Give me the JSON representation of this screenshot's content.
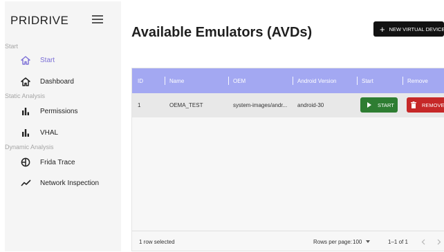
{
  "sidebar": {
    "brand": "PRIDRIVE",
    "sections": {
      "start": "Start",
      "static": "Static Analysis",
      "dynamic": "Dynamic Analysis"
    },
    "items": [
      {
        "label": "Start",
        "icon": "home-outline-icon",
        "active": true
      },
      {
        "label": "Dashboard",
        "icon": "home-icon",
        "active": false
      },
      {
        "label": "Permissions",
        "icon": "bar-chart-icon",
        "active": false
      },
      {
        "label": "VHAL",
        "icon": "bar-chart-icon",
        "active": false
      },
      {
        "label": "Frida Trace",
        "icon": "pie-chart-icon",
        "active": false
      },
      {
        "label": "Network Inspection",
        "icon": "trend-line-icon",
        "active": false
      }
    ]
  },
  "main": {
    "title": "Available Emulators (AVDs)",
    "new_button_label": "NEW VIRTUAL DEVICE"
  },
  "table": {
    "columns": [
      "ID",
      "Name",
      "OEM",
      "Android Version",
      "Start",
      "Remove"
    ],
    "rows": [
      {
        "id": "1",
        "name": "OEMA_TEST",
        "oem": "system-images/andr...",
        "android_version": "android-30",
        "start_label": "START",
        "remove_label": "REMOVE"
      }
    ],
    "footer": {
      "selected_text": "1 row selected",
      "rows_per_page_label": "Rows per page:",
      "rows_per_page_value": "100",
      "range_text": "1–1 of 1"
    }
  },
  "colors": {
    "accent": "#7b6fd6",
    "header_bg": "#a3a8f2",
    "start_green": "#2e7d32",
    "remove_red": "#c62828",
    "primary_dark": "#121212"
  }
}
